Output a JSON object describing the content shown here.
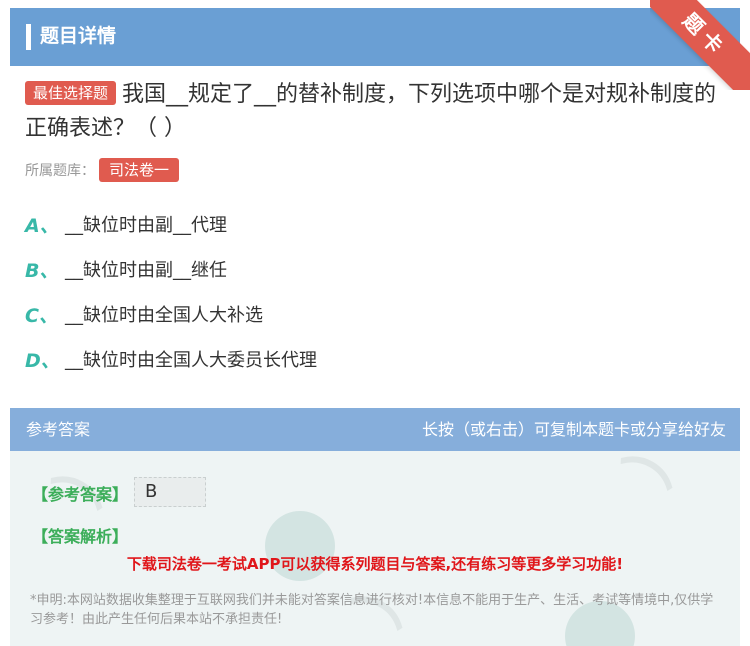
{
  "header": {
    "title": "题目详情",
    "ribbon_text": "题卡"
  },
  "question": {
    "tag": "最佳选择题",
    "text": "我国__规定了__的替补制度，下列选项中哪个是对规补制度的正确表述？（ ）",
    "source_label": "所属题库：",
    "source_tag": "司法卷一"
  },
  "options": [
    {
      "letter": "A、",
      "text": "__缺位时由副__代理"
    },
    {
      "letter": "B、",
      "text": "__缺位时由副__继任"
    },
    {
      "letter": "C、",
      "text": "__缺位时由全国人大补选"
    },
    {
      "letter": "D、",
      "text": "__缺位时由全国人大委员长代理"
    }
  ],
  "answer": {
    "header_left": "参考答案",
    "header_right": "长按（或右击）可复制本题卡或分享给好友",
    "answer_label": "【参考答案】",
    "answer_value": "B",
    "analysis_label": "【答案解析】",
    "promo": "下载司法卷一考试APP可以获得系列题目与答案,还有练习等更多学习功能!",
    "disclaimer": "*申明:本网站数据收集整理于互联网我们并未能对答案信息进行核对!本信息不能用于生产、生活、考试等情境中,仅供学习参考！由此产生任何后果本站不承担责任!"
  },
  "colors": {
    "header": "#6a9fd4",
    "accent_red": "#e05b4f",
    "option_letter": "#38b8a8",
    "answer_green": "#3cae5a",
    "promo_red": "#e0161a"
  }
}
